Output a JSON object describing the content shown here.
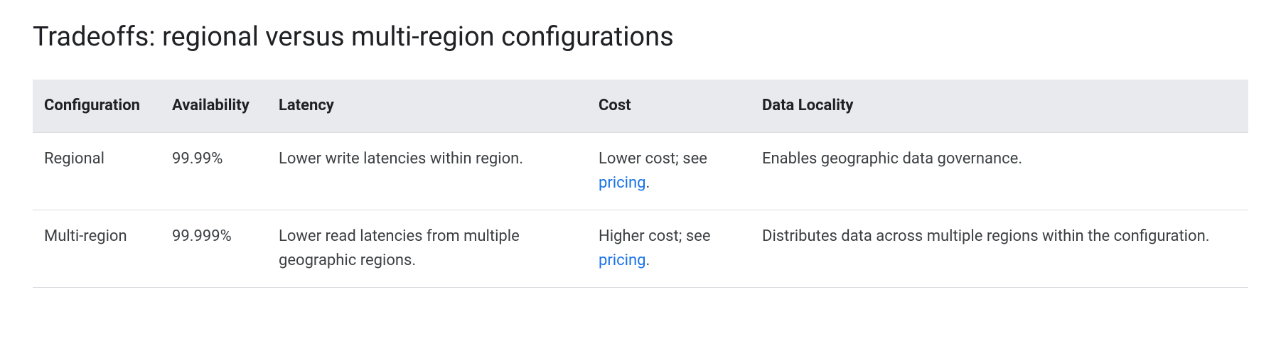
{
  "heading": "Tradeoffs: regional versus multi-region configurations",
  "table": {
    "headers": {
      "configuration": "Configuration",
      "availability": "Availability",
      "latency": "Latency",
      "cost": "Cost",
      "data_locality": "Data Locality"
    },
    "rows": [
      {
        "configuration": "Regional",
        "availability": "99.99%",
        "latency": "Lower write latencies within region.",
        "cost_prefix": "Lower cost; see ",
        "cost_link_text": "pricing",
        "cost_suffix": ".",
        "data_locality": "Enables geographic data governance."
      },
      {
        "configuration": "Multi-region",
        "availability": "99.999%",
        "latency": "Lower read latencies from multiple geographic regions.",
        "cost_prefix": "Higher cost; see ",
        "cost_link_text": "pricing",
        "cost_suffix": ".",
        "data_locality": "Distributes data across multiple regions within the configuration."
      }
    ]
  }
}
